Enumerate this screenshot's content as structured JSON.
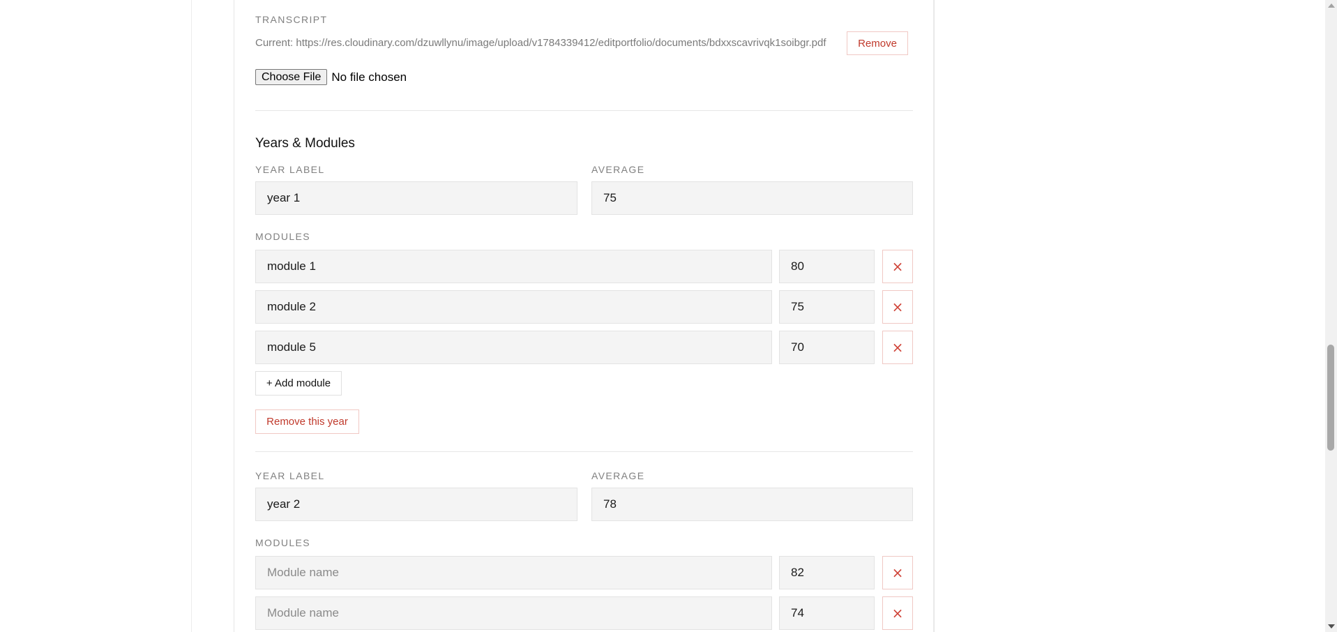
{
  "transcript": {
    "label": "TRANSCRIPT",
    "current_text": "Current: https://res.cloudinary.com/dzuwllynu/image/upload/v1784339412/editportfolio/documents/bdxxscavrivqk1soibgr.pdf",
    "remove_label": "Remove",
    "choose_file_label": "Choose File",
    "no_file_text": "No file chosen"
  },
  "years_section": {
    "title": "Years & Modules",
    "years": [
      {
        "year_label_heading": "YEAR LABEL",
        "year_label_value": "year 1",
        "average_heading": "AVERAGE",
        "average_value": "75",
        "modules_heading": "MODULES",
        "modules": [
          {
            "name": "module 1",
            "name_placeholder": "Module name",
            "score": "80",
            "remove_icon": "×"
          },
          {
            "name": "module 2",
            "name_placeholder": "Module name",
            "score": "75",
            "remove_icon": "×"
          },
          {
            "name": "module 5",
            "name_placeholder": "Module name",
            "score": "70",
            "remove_icon": "×"
          }
        ],
        "add_module_label": "+ Add module",
        "remove_year_label": "Remove this year"
      },
      {
        "year_label_heading": "YEAR LABEL",
        "year_label_value": "year 2",
        "average_heading": "AVERAGE",
        "average_value": "78",
        "modules_heading": "MODULES",
        "modules": [
          {
            "name": "",
            "name_placeholder": "Module name",
            "score": "82",
            "remove_icon": "×"
          },
          {
            "name": "",
            "name_placeholder": "Module name",
            "score": "74",
            "remove_icon": "×"
          }
        ]
      }
    ]
  },
  "colors": {
    "danger": "#c0392b",
    "danger_border": "#f0c8c4",
    "input_bg": "#f4f4f4",
    "label_gray": "#808080"
  }
}
